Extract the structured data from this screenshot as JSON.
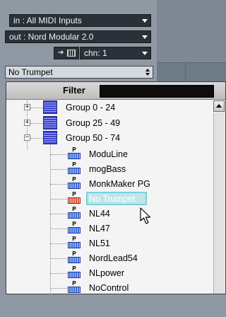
{
  "inspector": {
    "input_label": "in : All MIDI Inputs",
    "output_label": "out : Nord Modular 2.0",
    "channel_label": "chn: 1",
    "channel_icon": "midi-routing-icon",
    "program_label": "No Trumpet"
  },
  "browser": {
    "filter_label": "Filter",
    "filter_value": "",
    "groups": [
      {
        "label": "Group 0 - 24",
        "expanded": false
      },
      {
        "label": "Group 25 - 49",
        "expanded": false
      },
      {
        "label": "Group 50 - 74",
        "expanded": true
      }
    ],
    "programs": [
      {
        "label": "ModuLine"
      },
      {
        "label": "mogBass"
      },
      {
        "label": "MonkMaker PG"
      },
      {
        "label": "No Trumpet",
        "selected": true
      },
      {
        "label": "NL44"
      },
      {
        "label": "NL47"
      },
      {
        "label": "NL51"
      },
      {
        "label": "NordLead54"
      },
      {
        "label": "NLpower"
      },
      {
        "label": "NoControl"
      }
    ],
    "expander_collapsed": "+",
    "expander_expanded": "−"
  },
  "colors": {
    "selection_fill": "#bfe6ea",
    "selection_border": "#79d2d8",
    "group_icon": "#3d44c9",
    "program_icon": "#3f6ee0"
  }
}
